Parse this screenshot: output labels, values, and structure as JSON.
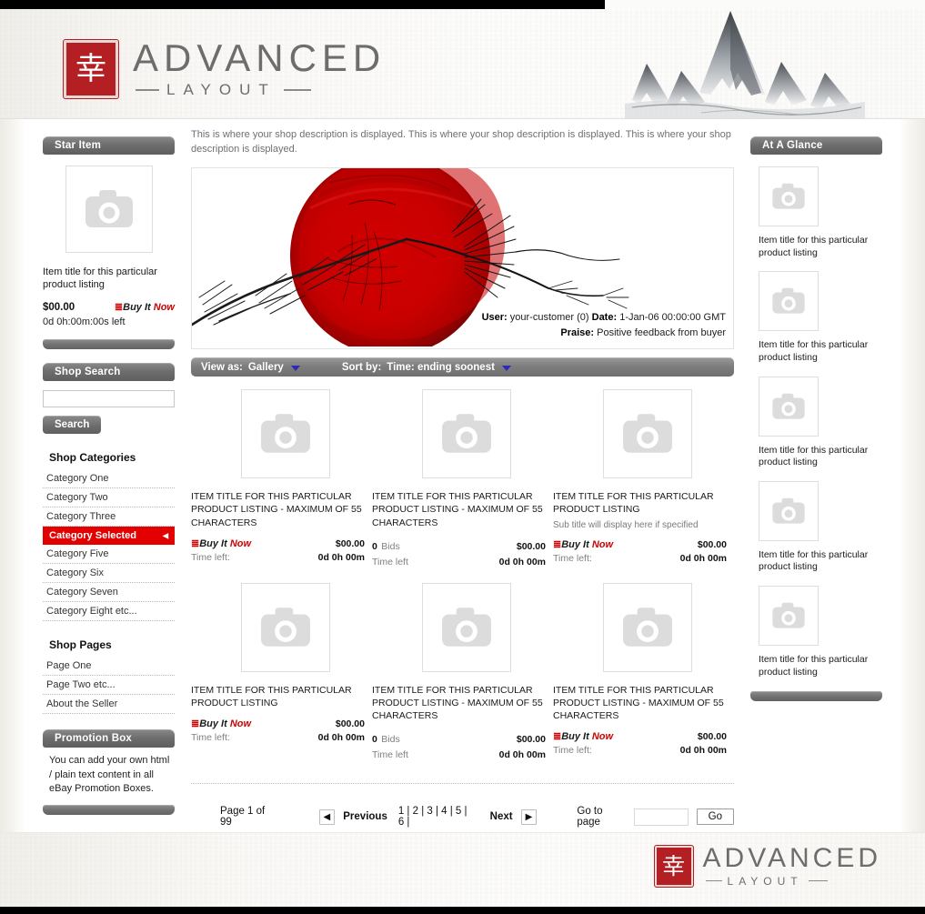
{
  "brand": {
    "seal_glyph": "幸",
    "name_top": "ADVANCED",
    "name_bottom": "LAYOUT"
  },
  "left_sidebar": {
    "star_item": {
      "header": "Star Item",
      "image_icon": "camera-placeholder-icon",
      "title": "Item title for this particular product listing",
      "price": "$00.00",
      "buy_it_now": {
        "buy": "Buy It",
        "now": "Now"
      },
      "time_left": "0d 0h:00m:00s left"
    },
    "shop_search": {
      "header": "Shop Search",
      "input_value": "",
      "input_placeholder": "",
      "button_label": "Search"
    },
    "shop_categories": {
      "title": "Shop Categories",
      "items": [
        {
          "label": "Category One",
          "selected": false
        },
        {
          "label": "Category Two",
          "selected": false
        },
        {
          "label": "Category Three",
          "selected": false
        },
        {
          "label": "Category Selected",
          "selected": true
        },
        {
          "label": "Category Five",
          "selected": false
        },
        {
          "label": "Category Six",
          "selected": false
        },
        {
          "label": "Category Seven",
          "selected": false
        },
        {
          "label": "Category Eight etc...",
          "selected": false
        }
      ]
    },
    "shop_pages": {
      "title": "Shop Pages",
      "items": [
        {
          "label": "Page One"
        },
        {
          "label": "Page Two etc..."
        },
        {
          "label": "About the Seller"
        }
      ]
    },
    "promotion_box": {
      "header": "Promotion Box",
      "text": "You can add your own html / plain text content in all eBay Promotion Boxes."
    }
  },
  "center": {
    "shop_description": "This is where your shop description is displayed. This is where your shop description is displayed. This is where your shop description is displayed.",
    "hero": {
      "user_label": "User:",
      "user_value": "your-customer (0)",
      "date_label": "Date:",
      "date_value": "1-Jan-06 00:00:00 GMT",
      "praise_label": "Praise:",
      "praise_value": "Positive feedback from buyer"
    },
    "toolbar": {
      "view_as_label": "View as:",
      "view_as_value": "Gallery",
      "sort_by_label": "Sort by:",
      "sort_by_value": "Time: ending soonest"
    },
    "listings": [
      {
        "title": "ITEM TITLE FOR THIS PARTICULAR PRODUCT LISTING - MAXIMUM OF 55 CHARACTERS",
        "subtitle": "",
        "format": "bin",
        "bin_buy": "Buy It",
        "bin_now": "Now",
        "price": "$00.00",
        "time_left_label": "Time left:",
        "time_left_value": "0d 0h 00m"
      },
      {
        "title": "ITEM TITLE FOR THIS PARTICULAR PRODUCT LISTING - MAXIMUM OF 55 CHARACTERS",
        "subtitle": "",
        "format": "bids",
        "bids_count": "0",
        "bids_label": "Bids",
        "price": "$00.00",
        "time_left_label": "Time left",
        "time_left_value": "0d 0h 00m"
      },
      {
        "title": "ITEM TITLE FOR THIS PARTICULAR PRODUCT LISTING",
        "subtitle": "Sub title will display here if specified",
        "format": "bin",
        "bin_buy": "Buy It",
        "bin_now": "Now",
        "price": "$00.00",
        "time_left_label": "Time left:",
        "time_left_value": "0d 0h 00m"
      },
      {
        "title": "ITEM TITLE FOR THIS PARTICULAR PRODUCT LISTING",
        "subtitle": "",
        "format": "bin",
        "bin_buy": "Buy It",
        "bin_now": "Now",
        "price": "$00.00",
        "time_left_label": "Time left:",
        "time_left_value": "0d 0h 00m"
      },
      {
        "title": "ITEM TITLE FOR THIS PARTICULAR PRODUCT LISTING - MAXIMUM OF 55 CHARACTERS",
        "subtitle": "",
        "format": "bids",
        "bids_count": "0",
        "bids_label": "Bids",
        "price": "$00.00",
        "time_left_label": "Time left",
        "time_left_value": "0d 0h 00m"
      },
      {
        "title": "ITEM TITLE FOR THIS PARTICULAR PRODUCT LISTING - MAXIMUM OF 55 CHARACTERS",
        "subtitle": "",
        "format": "bin",
        "bin_buy": "Buy It",
        "bin_now": "Now",
        "price": "$00.00",
        "time_left_label": "Time left:",
        "time_left_value": "0d 0h 00m"
      }
    ],
    "pagination": {
      "page_of": "Page 1 of 99",
      "previous_label": "Previous",
      "previous_arrow": "◀",
      "next_label": "Next",
      "next_arrow": "▶",
      "pages": "1 | 2 | 3 | 4 | 5 | 6 |",
      "goto_label": "Go to page",
      "goto_value": "",
      "go_button": "Go"
    }
  },
  "right_sidebar": {
    "at_a_glance": {
      "header": "At A Glance",
      "items": [
        {
          "title": "Item title for this particular product listing"
        },
        {
          "title": "Item title for this particular product listing"
        },
        {
          "title": "Item title for this particular product listing"
        },
        {
          "title": "Item title for this particular product listing"
        },
        {
          "title": "Item title for this particular product listing"
        }
      ]
    }
  },
  "colors": {
    "accent_red": "#e20000",
    "seal_red": "#b41f24",
    "panel_gray": "#6e6e6e",
    "caret_blue": "#2b2bbb"
  }
}
